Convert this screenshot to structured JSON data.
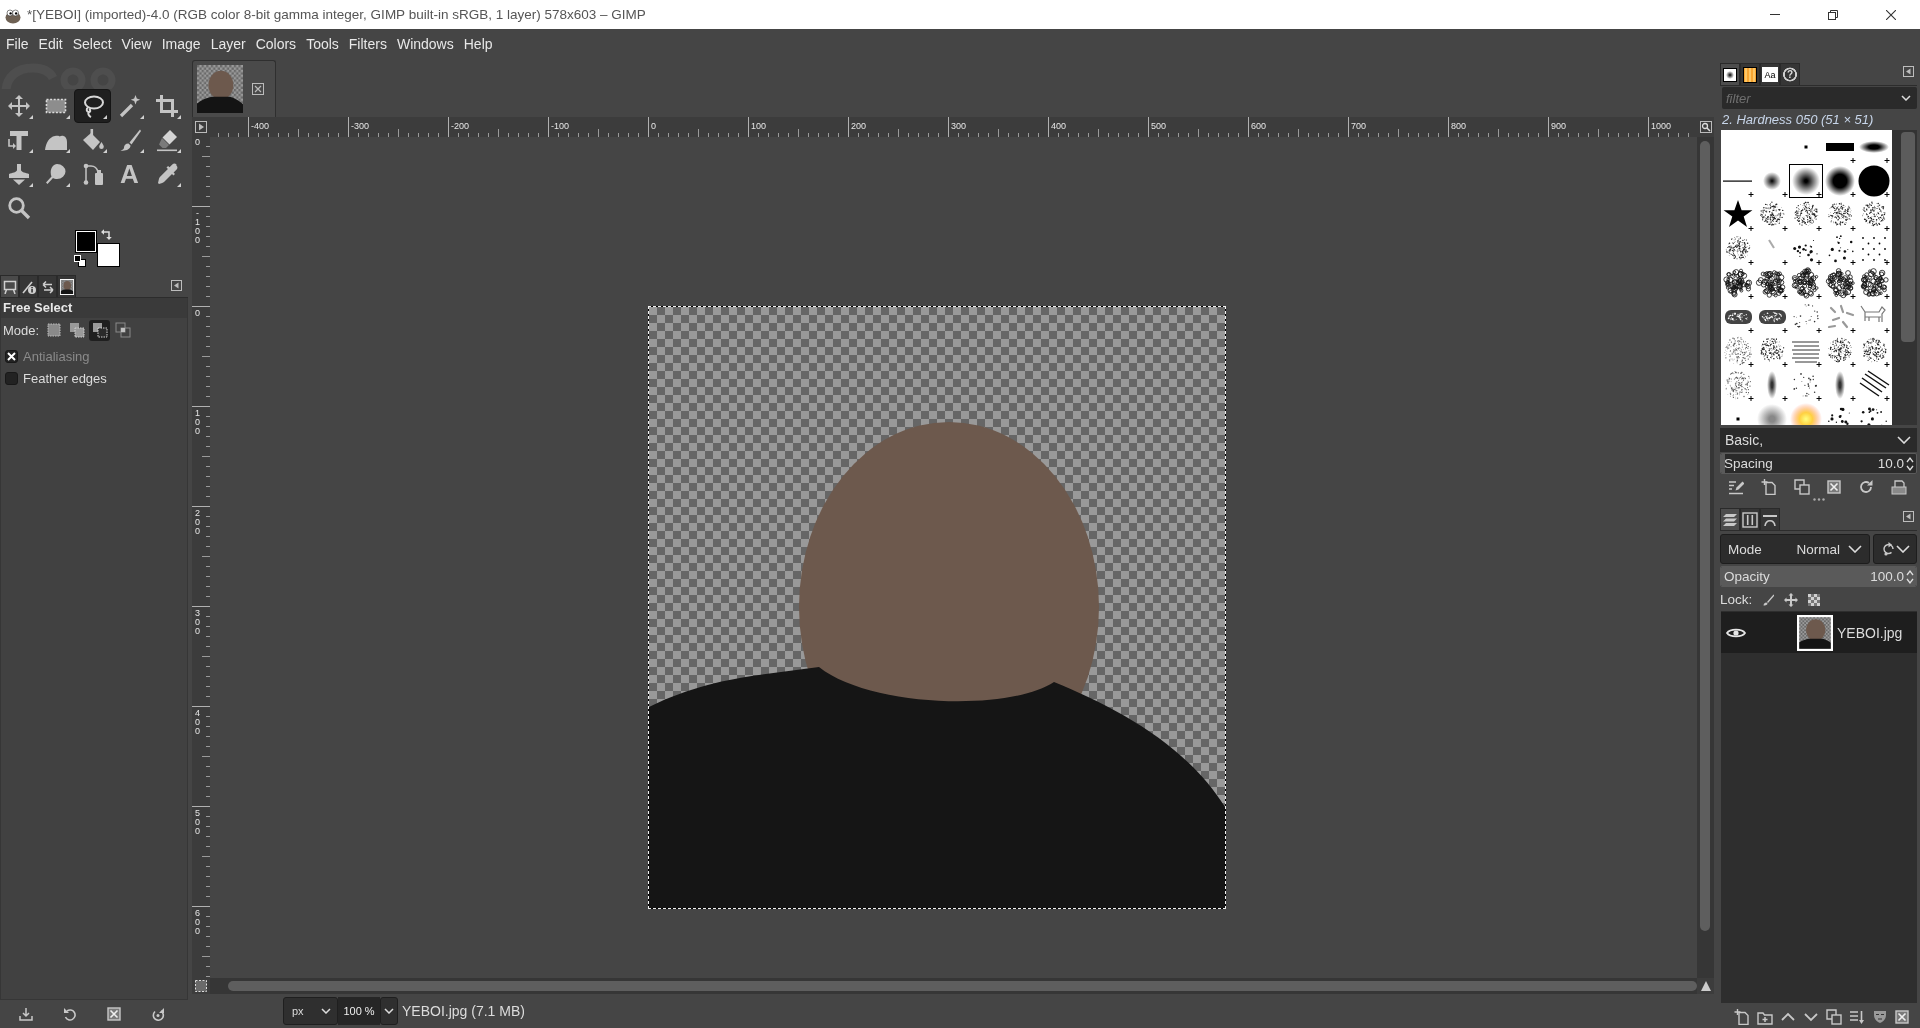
{
  "window": {
    "title": "*[YEBOI] (imported)-4.0 (RGB color 8-bit gamma integer, GIMP built-in sRGB, 1 layer) 578x603 – GIMP"
  },
  "menu": [
    "File",
    "Edit",
    "Select",
    "View",
    "Image",
    "Layer",
    "Colors",
    "Tools",
    "Filters",
    "Windows",
    "Help"
  ],
  "toolbox": {
    "tools": [
      {
        "kind": "move",
        "grouped": true,
        "selected": false
      },
      {
        "kind": "rect-select",
        "grouped": true,
        "selected": false
      },
      {
        "kind": "free-select",
        "grouped": true,
        "selected": true
      },
      {
        "kind": "fuzzy-select",
        "grouped": true,
        "selected": false
      },
      {
        "kind": "crop",
        "grouped": true,
        "selected": false
      },
      {
        "kind": "transform",
        "grouped": true,
        "selected": false
      },
      {
        "kind": "warp",
        "grouped": true,
        "selected": false
      },
      {
        "kind": "bucket",
        "grouped": true,
        "selected": false
      },
      {
        "kind": "paintbrush",
        "grouped": true,
        "selected": false
      },
      {
        "kind": "eraser",
        "grouped": true,
        "selected": false
      },
      {
        "kind": "clone",
        "grouped": true,
        "selected": false
      },
      {
        "kind": "smudge",
        "grouped": true,
        "selected": false
      },
      {
        "kind": "paths",
        "grouped": false,
        "selected": false
      },
      {
        "kind": "text",
        "glyph": "A",
        "grouped": false,
        "selected": false
      },
      {
        "kind": "color-picker",
        "grouped": true,
        "selected": false
      },
      {
        "kind": "zoom",
        "grouped": false,
        "selected": false
      }
    ],
    "colors": [
      {
        "kind": "foreground",
        "color": "#000000"
      },
      {
        "kind": "background",
        "color": "#ffffff"
      }
    ]
  },
  "tool_options": {
    "tabs": [
      {
        "kind": "tool-options",
        "selected": true
      },
      {
        "kind": "device-status",
        "selected": false
      },
      {
        "kind": "undo-history",
        "selected": false
      },
      {
        "kind": "images",
        "selected": false
      }
    ],
    "title": "Free Select",
    "mode_label": "Mode:",
    "modes": [
      {
        "kind": "replace",
        "selected": false
      },
      {
        "kind": "add",
        "selected": false
      },
      {
        "kind": "subtract",
        "selected": true
      },
      {
        "kind": "intersect",
        "selected": false
      }
    ],
    "options": [
      {
        "label": "Antialiasing",
        "checked": true,
        "disabled": true
      },
      {
        "label": "Feather edges",
        "checked": false,
        "disabled": false
      }
    ]
  },
  "image_window": {
    "rulers": {
      "horizontal": [
        "-400",
        "-300",
        "-200",
        "-100",
        "0",
        "100",
        "200",
        "300",
        "400",
        "500",
        "600",
        "700",
        "800",
        "900",
        "1000"
      ],
      "vertical": [
        "0",
        "-100",
        "0",
        "100",
        "200",
        "300",
        "400",
        "500",
        "600"
      ]
    },
    "status_bar": {
      "unit": "px",
      "zoom": "100 %",
      "file_info": "YEBOI.jpg (7.1 MB)"
    }
  },
  "brushes": {
    "tabs": [
      {
        "kind": "brushes",
        "selected": true
      },
      {
        "kind": "gradients",
        "selected": false
      },
      {
        "kind": "fonts",
        "glyph": "Aa",
        "selected": false
      },
      {
        "kind": "help",
        "glyph": "?",
        "selected": false
      }
    ],
    "filter_placeholder": "filter",
    "current": "2. Hardness 050 (51 × 51)",
    "items": [
      {
        "kind": "pixel",
        "selected": false
      },
      {
        "kind": "block",
        "selected": false
      },
      {
        "kind": "ellipse",
        "selected": false
      },
      {
        "kind": "line",
        "selected": false
      },
      {
        "kind": "soft-small",
        "selected": false
      },
      {
        "kind": "soft-medium",
        "selected": true
      },
      {
        "kind": "soft-large",
        "selected": false
      },
      {
        "kind": "hard",
        "selected": false
      },
      {
        "kind": "star",
        "selected": false
      },
      {
        "kind": "splatter",
        "selected": false
      },
      {
        "kind": "splatter",
        "selected": false
      },
      {
        "kind": "splatter",
        "selected": false
      },
      {
        "kind": "splatter",
        "selected": false
      },
      {
        "kind": "splatter",
        "selected": false
      },
      {
        "kind": "streak",
        "selected": false
      },
      {
        "kind": "scatter",
        "selected": false
      },
      {
        "kind": "scatter",
        "selected": false
      },
      {
        "kind": "dots",
        "selected": false
      },
      {
        "kind": "sponge",
        "selected": false
      },
      {
        "kind": "sponge",
        "selected": false
      },
      {
        "kind": "sponge",
        "selected": false
      },
      {
        "kind": "sponge",
        "selected": false
      },
      {
        "kind": "sponge",
        "selected": false
      },
      {
        "kind": "band",
        "selected": false
      },
      {
        "kind": "band",
        "selected": false
      },
      {
        "kind": "specks",
        "selected": false
      },
      {
        "kind": "sticks",
        "selected": false
      },
      {
        "kind": "figure",
        "selected": false
      },
      {
        "kind": "speckle",
        "selected": false
      },
      {
        "kind": "splatter",
        "selected": false
      },
      {
        "kind": "strokes",
        "selected": false
      },
      {
        "kind": "splatter",
        "selected": false
      },
      {
        "kind": "splatter",
        "selected": false
      },
      {
        "kind": "speckle",
        "selected": false
      },
      {
        "kind": "smudge",
        "selected": false
      },
      {
        "kind": "specks",
        "selected": false
      },
      {
        "kind": "smudge",
        "selected": false
      },
      {
        "kind": "hatch",
        "selected": false
      },
      {
        "kind": "pixel",
        "selected": false
      },
      {
        "kind": "cloud",
        "selected": false
      },
      {
        "kind": "glow",
        "selected": false
      },
      {
        "kind": "scatter",
        "selected": false
      },
      {
        "kind": "scatter",
        "selected": false
      }
    ],
    "tag": "Basic,",
    "spacing": {
      "label": "Spacing",
      "value": "10.0",
      "level": 0.02
    }
  },
  "layers": {
    "tabs": [
      {
        "kind": "layers",
        "selected": true
      },
      {
        "kind": "channels",
        "selected": false
      },
      {
        "kind": "paths",
        "selected": false
      }
    ],
    "mode_label": "Mode",
    "mode": "Normal",
    "opacity": {
      "label": "Opacity",
      "value": "100.0",
      "level": 1
    },
    "lock_label": "Lock:",
    "items": [
      {
        "name": "YEBOI.jpg",
        "visible": true,
        "selected": true
      }
    ]
  }
}
